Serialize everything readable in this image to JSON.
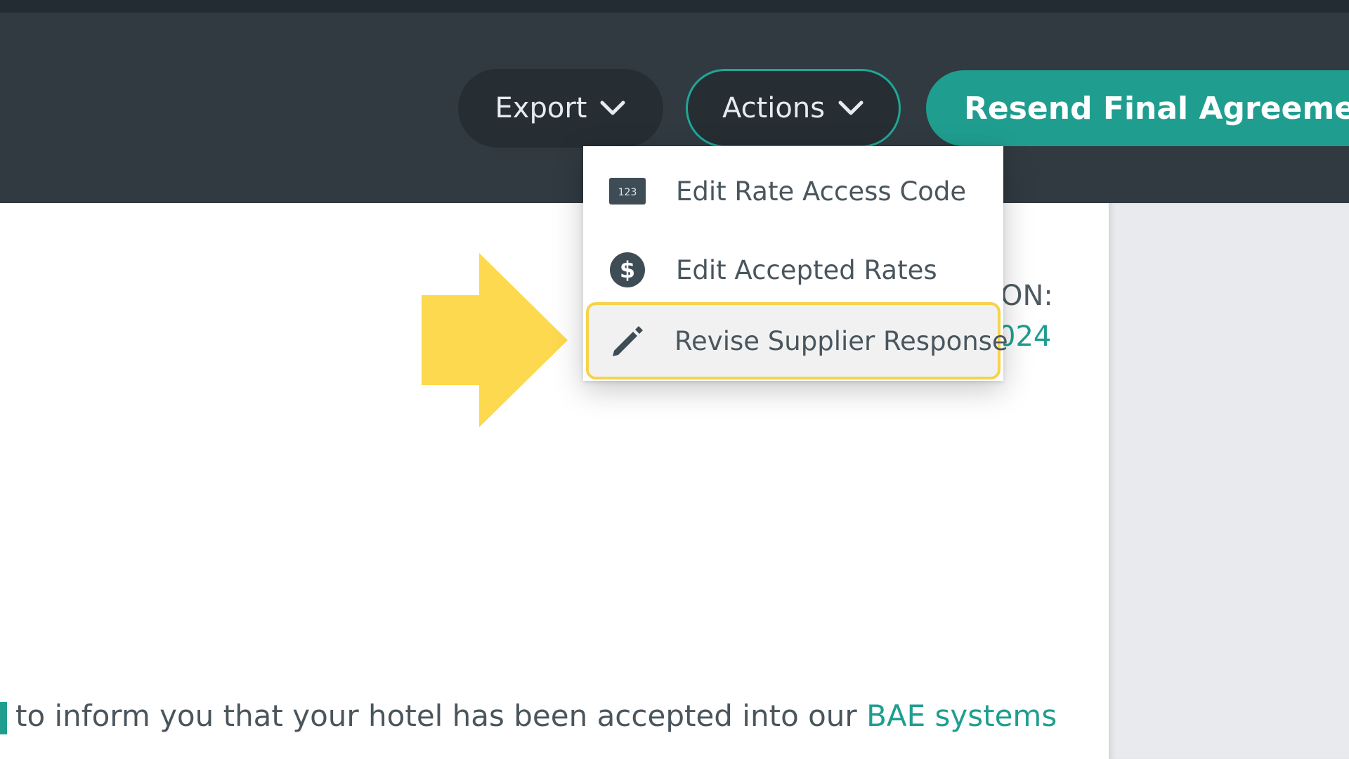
{
  "header": {
    "export_label": "Export",
    "actions_label": "Actions",
    "resend_label": "Resend Final Agreemen"
  },
  "actions_menu": {
    "items": [
      {
        "label": "Edit Rate Access Code",
        "icon": "rate-code-icon"
      },
      {
        "label": "Edit Accepted Rates",
        "icon": "dollar-icon"
      },
      {
        "label": "Revise Supplier Response",
        "icon": "pencil-icon"
      }
    ]
  },
  "content": {
    "date_label": "ON:",
    "date_value": "024",
    "body_text": "to inform you that your hotel has been accepted into our",
    "body_link": "BAE systems"
  },
  "colors": {
    "header_bg": "#303a40",
    "accent": "#1f9e90",
    "highlight": "#f7d24a",
    "arrow": "#fdd94f"
  }
}
